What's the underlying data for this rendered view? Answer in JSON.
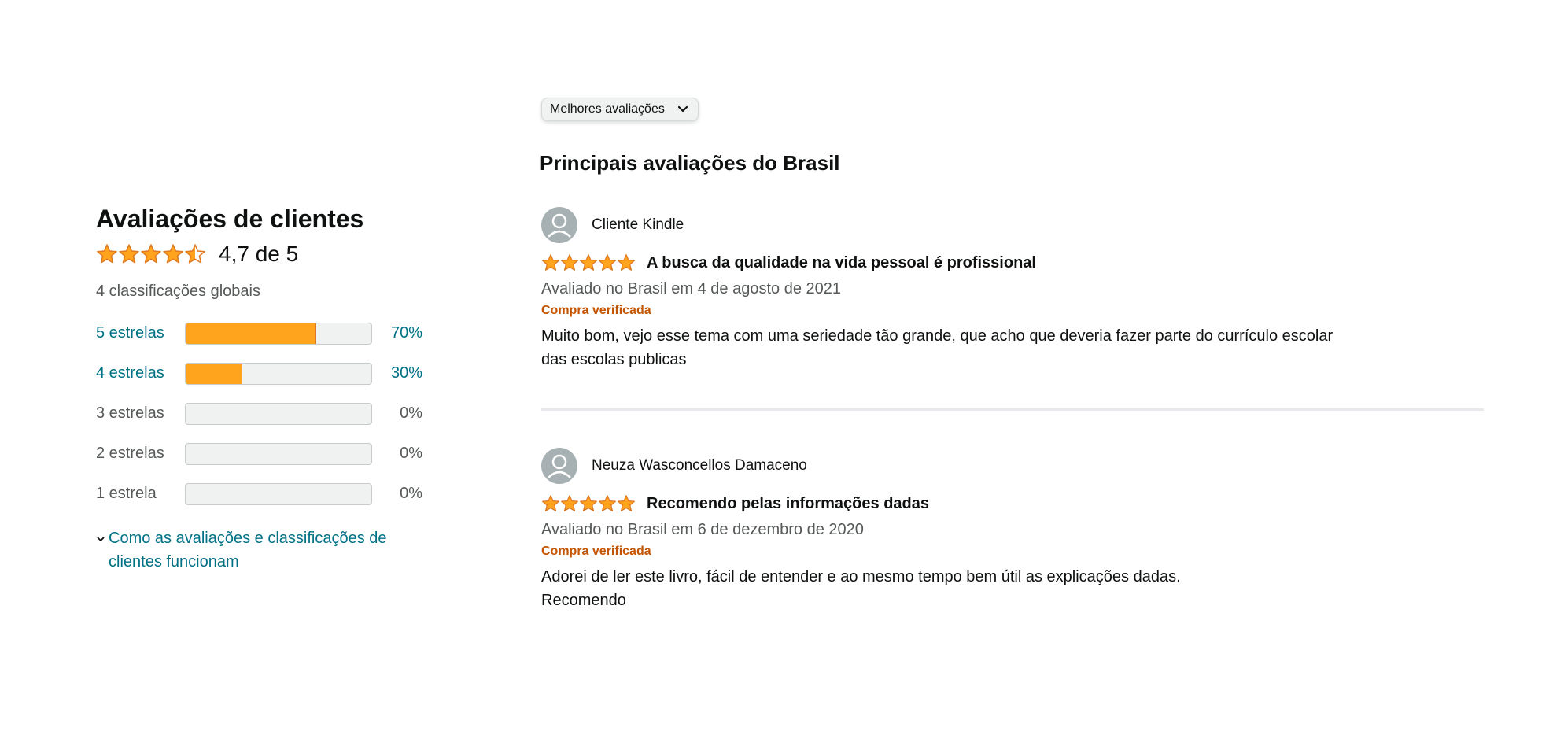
{
  "summary": {
    "title": "Avaliações de clientes",
    "rating_value": 4.7,
    "rating_text": "4,7 de 5",
    "global_count": "4 classificações globais"
  },
  "histogram": [
    {
      "label": "5 estrelas",
      "percent_text": "70%",
      "percent": 70,
      "link": true
    },
    {
      "label": "4 estrelas",
      "percent_text": "30%",
      "percent": 30,
      "link": true
    },
    {
      "label": "3 estrelas",
      "percent_text": "0%",
      "percent": 0,
      "link": false
    },
    {
      "label": "2 estrelas",
      "percent_text": "0%",
      "percent": 0,
      "link": false
    },
    {
      "label": "1 estrela",
      "percent_text": "0%",
      "percent": 0,
      "link": false
    }
  ],
  "how_link": "Como as avaliações e classificações de clientes funcionam",
  "sort": {
    "selected": "Melhores avaliações"
  },
  "reviews_title": "Principais avaliações do Brasil",
  "reviews": [
    {
      "name": "Cliente Kindle",
      "stars": 5,
      "title": "A busca da qualidade na vida pessoal é profissional",
      "date": "Avaliado no Brasil em 4 de agosto de 2021",
      "verified": "Compra verificada",
      "body": "Muito bom, vejo esse tema com uma seriedade tão grande, que acho que deveria fazer parte do currículo escolar das escolas publicas"
    },
    {
      "name": "Neuza Wasconcellos Damaceno",
      "stars": 5,
      "title": "Recomendo pelas informações dadas",
      "date": "Avaliado no Brasil em 6 de dezembro de 2020",
      "verified": "Compra verificada",
      "body": "Adorei de ler este livro, fácil de entender e ao mesmo tempo bem útil as explicações dadas.\nRecomendo"
    }
  ],
  "colors": {
    "star": "#ffa41c",
    "star_stroke": "#de7921",
    "link": "#007185",
    "verified": "#c45500"
  }
}
